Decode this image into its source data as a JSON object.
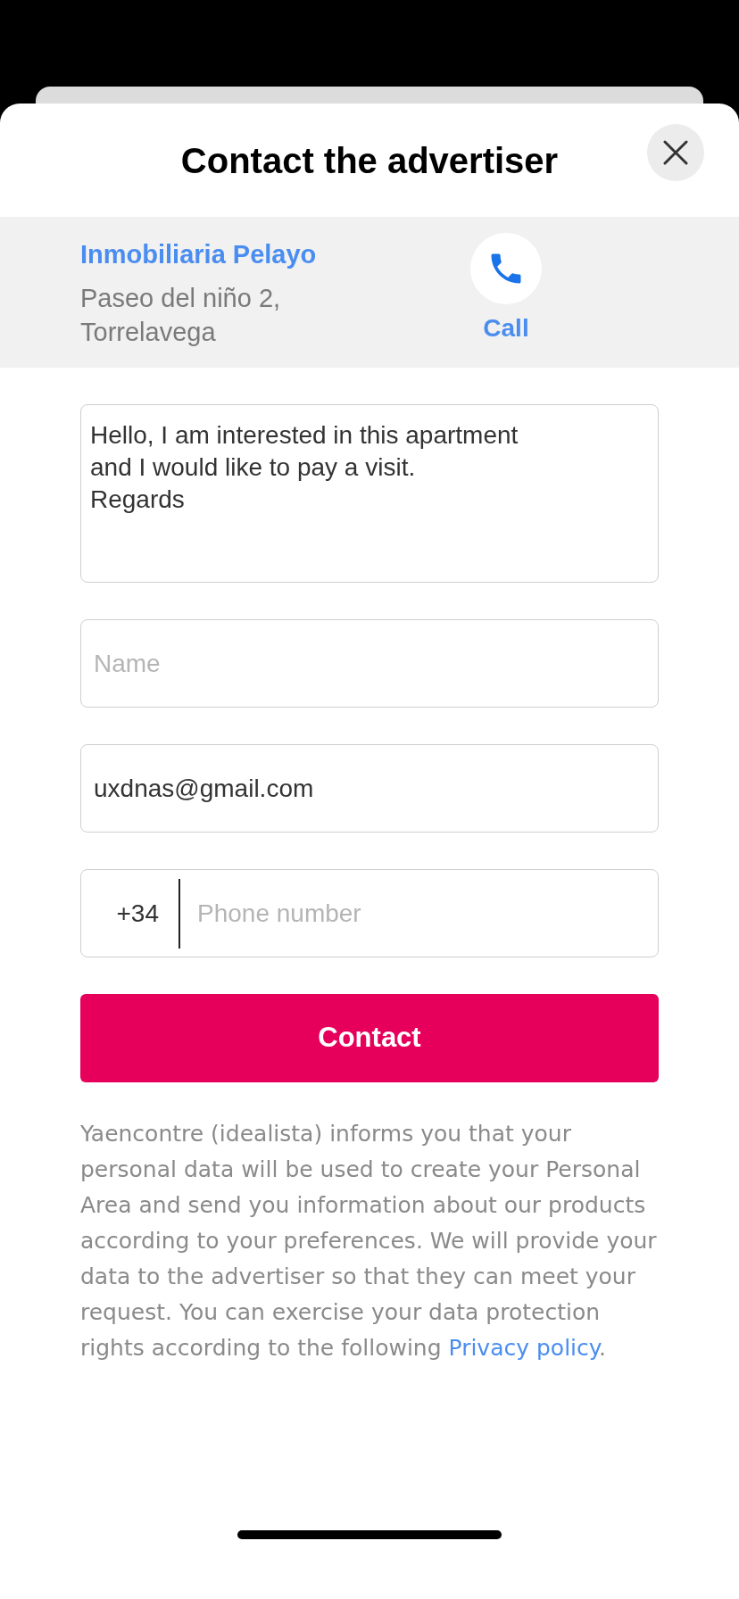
{
  "dialog": {
    "title": "Contact the advertiser"
  },
  "advertiser": {
    "name": "Inmobiliaria Pelayo",
    "address": "Paseo del niño 2,\nTorrelavega",
    "call_label": "Call"
  },
  "form": {
    "message": "Hello, I am interested in this apartment\nand I would like to pay a visit.\nRegards",
    "name_placeholder": "Name",
    "email": "uxdnas@gmail.com",
    "phone_prefix": "+34",
    "phone_placeholder": "Phone number",
    "submit": "Contact"
  },
  "disclaimer": {
    "text": "Yaencontre (idealista) informs you that your personal data will be used to create your Personal Area and send you information about our products according to your preferences. We will provide your data to the advertiser so that they can meet your request. You can exercise your data protection rights according to the following ",
    "link": "Privacy policy",
    "end": "."
  }
}
